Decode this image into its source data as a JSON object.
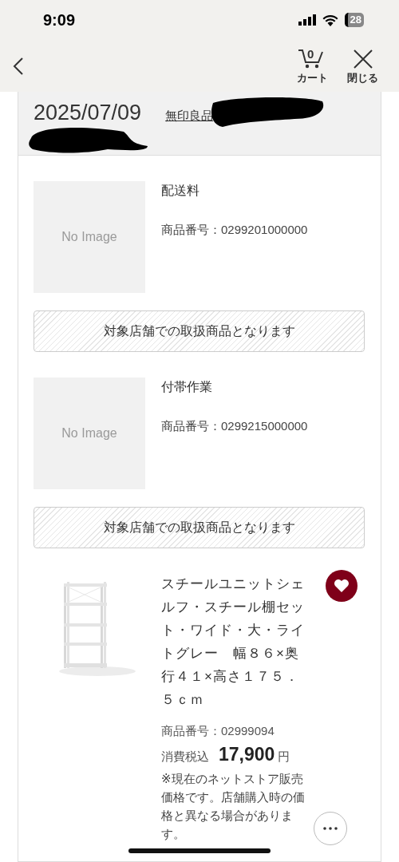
{
  "status_bar": {
    "time": "9:09",
    "battery": "28"
  },
  "nav": {
    "cart_count": "0",
    "cart_label": "カート",
    "close_label": "閉じる"
  },
  "order": {
    "date": "2025/07/09",
    "store": "無印良品"
  },
  "items": [
    {
      "kind": "noimage",
      "image_text": "No Image",
      "name": "配送料",
      "number": "商品番号：0299201000000",
      "notice": "対象店舗での取扱商品となります"
    },
    {
      "kind": "noimage",
      "image_text": "No Image",
      "name": "付帯作業",
      "number": "商品番号：0299215000000",
      "notice": "対象店舗での取扱商品となります"
    },
    {
      "kind": "product",
      "name": "スチールユニットシェルフ・スチール棚セット・ワイド・大・ライトグレー　幅８６×奥行４１×高さ１７５．５ｃｍ",
      "number": "商品番号：02999094",
      "price_label": "消費税込",
      "price": "17,900",
      "currency": "円",
      "note": "※現在のネットストア販売価格です。店舗購入時の価格と異なる場合があります。",
      "favorited": true
    }
  ]
}
